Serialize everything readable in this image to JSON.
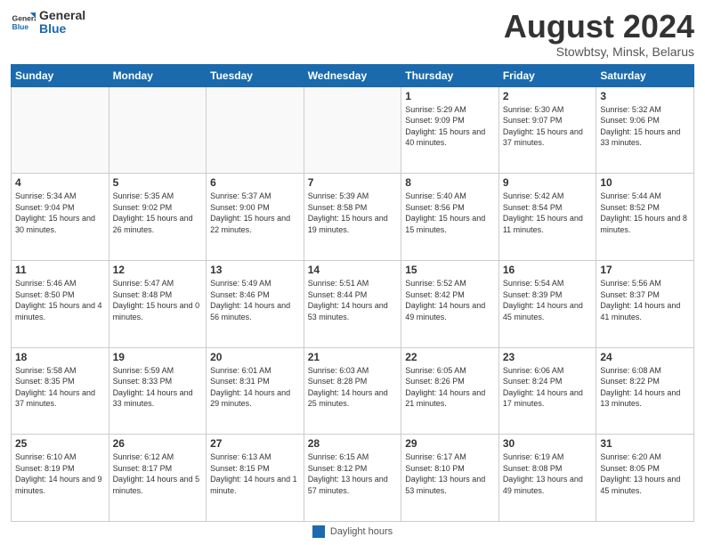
{
  "header": {
    "logo_line1": "General",
    "logo_line2": "Blue",
    "month_title": "August 2024",
    "subtitle": "Stowbtsy, Minsk, Belarus"
  },
  "weekdays": [
    "Sunday",
    "Monday",
    "Tuesday",
    "Wednesday",
    "Thursday",
    "Friday",
    "Saturday"
  ],
  "footer": {
    "swatch_label": "Daylight hours"
  },
  "weeks": [
    [
      {
        "day": "",
        "info": ""
      },
      {
        "day": "",
        "info": ""
      },
      {
        "day": "",
        "info": ""
      },
      {
        "day": "",
        "info": ""
      },
      {
        "day": "1",
        "info": "Sunrise: 5:29 AM\nSunset: 9:09 PM\nDaylight: 15 hours\nand 40 minutes."
      },
      {
        "day": "2",
        "info": "Sunrise: 5:30 AM\nSunset: 9:07 PM\nDaylight: 15 hours\nand 37 minutes."
      },
      {
        "day": "3",
        "info": "Sunrise: 5:32 AM\nSunset: 9:06 PM\nDaylight: 15 hours\nand 33 minutes."
      }
    ],
    [
      {
        "day": "4",
        "info": "Sunrise: 5:34 AM\nSunset: 9:04 PM\nDaylight: 15 hours\nand 30 minutes."
      },
      {
        "day": "5",
        "info": "Sunrise: 5:35 AM\nSunset: 9:02 PM\nDaylight: 15 hours\nand 26 minutes."
      },
      {
        "day": "6",
        "info": "Sunrise: 5:37 AM\nSunset: 9:00 PM\nDaylight: 15 hours\nand 22 minutes."
      },
      {
        "day": "7",
        "info": "Sunrise: 5:39 AM\nSunset: 8:58 PM\nDaylight: 15 hours\nand 19 minutes."
      },
      {
        "day": "8",
        "info": "Sunrise: 5:40 AM\nSunset: 8:56 PM\nDaylight: 15 hours\nand 15 minutes."
      },
      {
        "day": "9",
        "info": "Sunrise: 5:42 AM\nSunset: 8:54 PM\nDaylight: 15 hours\nand 11 minutes."
      },
      {
        "day": "10",
        "info": "Sunrise: 5:44 AM\nSunset: 8:52 PM\nDaylight: 15 hours\nand 8 minutes."
      }
    ],
    [
      {
        "day": "11",
        "info": "Sunrise: 5:46 AM\nSunset: 8:50 PM\nDaylight: 15 hours\nand 4 minutes."
      },
      {
        "day": "12",
        "info": "Sunrise: 5:47 AM\nSunset: 8:48 PM\nDaylight: 15 hours\nand 0 minutes."
      },
      {
        "day": "13",
        "info": "Sunrise: 5:49 AM\nSunset: 8:46 PM\nDaylight: 14 hours\nand 56 minutes."
      },
      {
        "day": "14",
        "info": "Sunrise: 5:51 AM\nSunset: 8:44 PM\nDaylight: 14 hours\nand 53 minutes."
      },
      {
        "day": "15",
        "info": "Sunrise: 5:52 AM\nSunset: 8:42 PM\nDaylight: 14 hours\nand 49 minutes."
      },
      {
        "day": "16",
        "info": "Sunrise: 5:54 AM\nSunset: 8:39 PM\nDaylight: 14 hours\nand 45 minutes."
      },
      {
        "day": "17",
        "info": "Sunrise: 5:56 AM\nSunset: 8:37 PM\nDaylight: 14 hours\nand 41 minutes."
      }
    ],
    [
      {
        "day": "18",
        "info": "Sunrise: 5:58 AM\nSunset: 8:35 PM\nDaylight: 14 hours\nand 37 minutes."
      },
      {
        "day": "19",
        "info": "Sunrise: 5:59 AM\nSunset: 8:33 PM\nDaylight: 14 hours\nand 33 minutes."
      },
      {
        "day": "20",
        "info": "Sunrise: 6:01 AM\nSunset: 8:31 PM\nDaylight: 14 hours\nand 29 minutes."
      },
      {
        "day": "21",
        "info": "Sunrise: 6:03 AM\nSunset: 8:28 PM\nDaylight: 14 hours\nand 25 minutes."
      },
      {
        "day": "22",
        "info": "Sunrise: 6:05 AM\nSunset: 8:26 PM\nDaylight: 14 hours\nand 21 minutes."
      },
      {
        "day": "23",
        "info": "Sunrise: 6:06 AM\nSunset: 8:24 PM\nDaylight: 14 hours\nand 17 minutes."
      },
      {
        "day": "24",
        "info": "Sunrise: 6:08 AM\nSunset: 8:22 PM\nDaylight: 14 hours\nand 13 minutes."
      }
    ],
    [
      {
        "day": "25",
        "info": "Sunrise: 6:10 AM\nSunset: 8:19 PM\nDaylight: 14 hours\nand 9 minutes."
      },
      {
        "day": "26",
        "info": "Sunrise: 6:12 AM\nSunset: 8:17 PM\nDaylight: 14 hours\nand 5 minutes."
      },
      {
        "day": "27",
        "info": "Sunrise: 6:13 AM\nSunset: 8:15 PM\nDaylight: 14 hours\nand 1 minute."
      },
      {
        "day": "28",
        "info": "Sunrise: 6:15 AM\nSunset: 8:12 PM\nDaylight: 13 hours\nand 57 minutes."
      },
      {
        "day": "29",
        "info": "Sunrise: 6:17 AM\nSunset: 8:10 PM\nDaylight: 13 hours\nand 53 minutes."
      },
      {
        "day": "30",
        "info": "Sunrise: 6:19 AM\nSunset: 8:08 PM\nDaylight: 13 hours\nand 49 minutes."
      },
      {
        "day": "31",
        "info": "Sunrise: 6:20 AM\nSunset: 8:05 PM\nDaylight: 13 hours\nand 45 minutes."
      }
    ]
  ]
}
